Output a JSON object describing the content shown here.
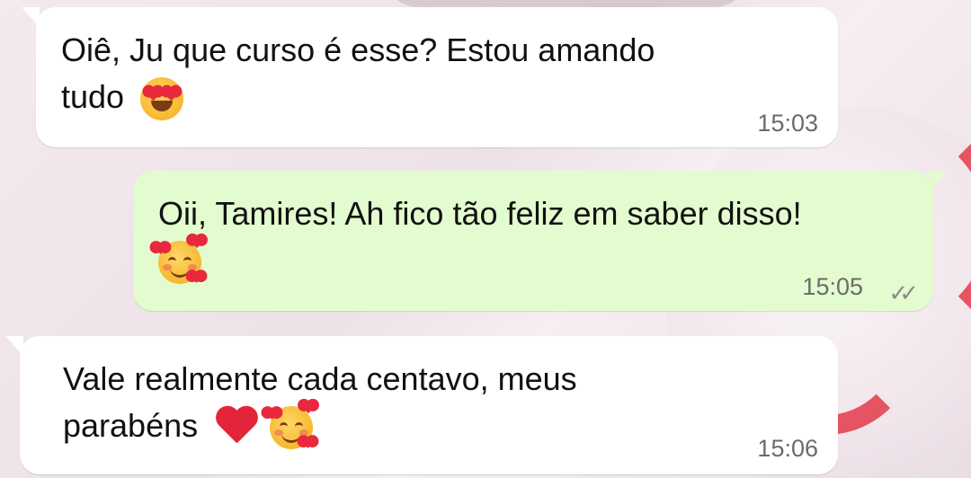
{
  "messages": [
    {
      "direction": "incoming",
      "text_line1": "Oiê, Ju que curso é esse? Estou amando",
      "text_line2": "tudo",
      "emoji": "smiling-face-with-heart-eyes-icon",
      "time": "15:03"
    },
    {
      "direction": "outgoing",
      "text_line1": "Oii, Tamires! Ah fico tão feliz em saber disso!",
      "emoji": "smiling-face-with-hearts-icon",
      "time": "15:05",
      "status": "read"
    },
    {
      "direction": "incoming",
      "text_line1": "Vale realmente cada centavo, meus",
      "text_line2": "parabéns",
      "emojis": [
        "red-heart-icon",
        "smiling-face-with-hearts-icon"
      ],
      "time": "15:06"
    }
  ],
  "colors": {
    "incoming_bubble": "#ffffff",
    "outgoing_bubble": "#e3fccf",
    "timestamp": "#6b6b6b"
  }
}
